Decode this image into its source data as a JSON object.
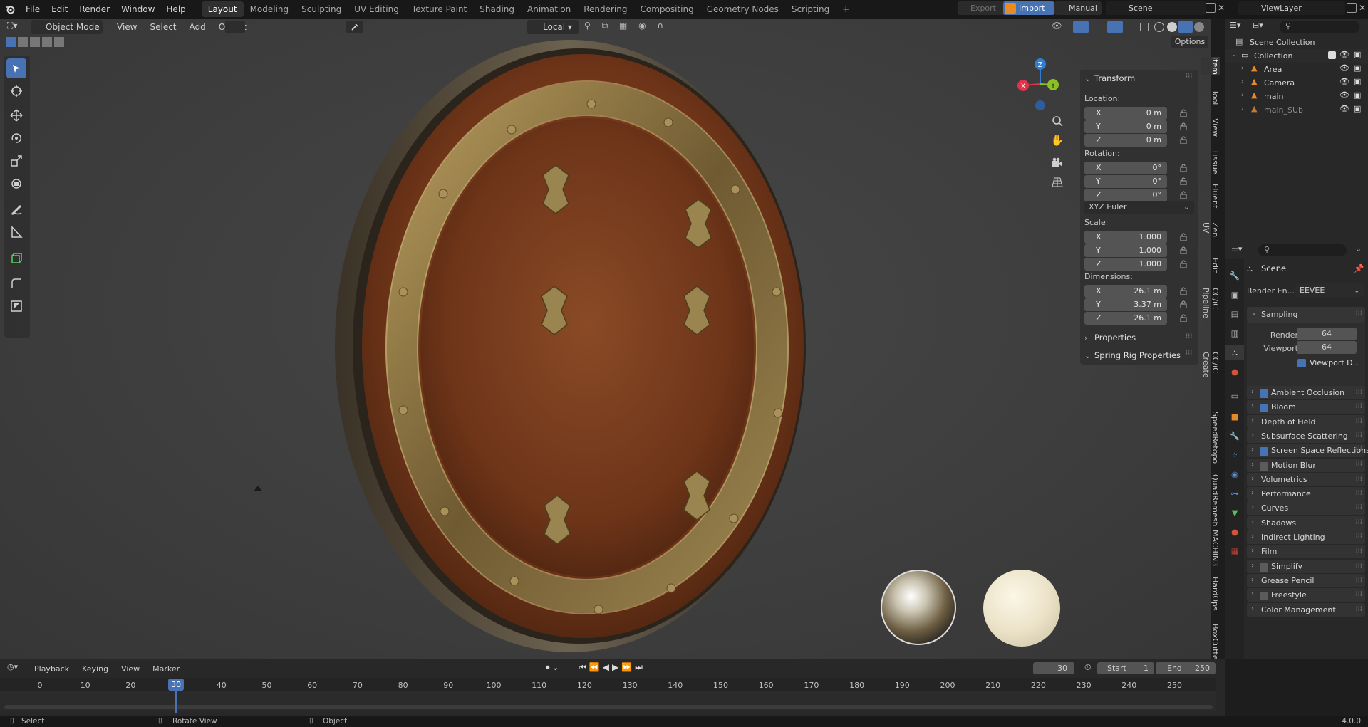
{
  "topbar": {
    "menus": [
      "File",
      "Edit",
      "Render",
      "Window",
      "Help"
    ],
    "workspaces": [
      "Layout",
      "Modeling",
      "Sculpting",
      "UV Editing",
      "Texture Paint",
      "Shading",
      "Animation",
      "Rendering",
      "Compositing",
      "Geometry Nodes",
      "Scripting"
    ],
    "active_workspace": "Layout",
    "add_tab": "+",
    "export_label": "Export",
    "import_label": "Import",
    "manual_label": "Manual",
    "scene_name": "Scene",
    "view_layer": "ViewLayer"
  },
  "viewport_header": {
    "mode": "Object Mode",
    "menus": [
      "View",
      "Select",
      "Add",
      "Object"
    ],
    "pivot": "Local",
    "options_label": "Options"
  },
  "gizmo": {
    "x": "X",
    "y": "Y",
    "z": "Z"
  },
  "n_panel": {
    "transform_title": "Transform",
    "location_label": "Location:",
    "location": [
      {
        "axis": "X",
        "value": "0 m"
      },
      {
        "axis": "Y",
        "value": "0 m"
      },
      {
        "axis": "Z",
        "value": "0 m"
      }
    ],
    "rotation_label": "Rotation:",
    "rotation": [
      {
        "axis": "X",
        "value": "0°"
      },
      {
        "axis": "Y",
        "value": "0°"
      },
      {
        "axis": "Z",
        "value": "0°"
      }
    ],
    "rotation_mode": "XYZ Euler",
    "scale_label": "Scale:",
    "scale": [
      {
        "axis": "X",
        "value": "1.000"
      },
      {
        "axis": "Y",
        "value": "1.000"
      },
      {
        "axis": "Z",
        "value": "1.000"
      }
    ],
    "dimensions_label": "Dimensions:",
    "dimensions": [
      {
        "axis": "X",
        "value": "26.1 m"
      },
      {
        "axis": "Y",
        "value": "3.37 m"
      },
      {
        "axis": "Z",
        "value": "26.1 m"
      }
    ],
    "properties_label": "Properties",
    "spring_rig_label": "Spring Rig Properties"
  },
  "side_tabs": [
    "Item",
    "Tool",
    "View",
    "Tissue",
    "Fluent",
    "Zen UV",
    "Edit",
    "CC/iC Pipeline",
    "CC/iC Create",
    "SpeedRetopo",
    "QuadRemesh",
    "MACHIN3",
    "HardOps",
    "BoxCutter"
  ],
  "outliner": {
    "root": "Scene Collection",
    "collection": "Collection",
    "items": [
      {
        "name": "Area",
        "dim": false
      },
      {
        "name": "Camera",
        "dim": false
      },
      {
        "name": "main",
        "dim": false
      },
      {
        "name": "main_SUb",
        "dim": true
      }
    ]
  },
  "properties": {
    "context": "Scene",
    "render_engine_label": "Render En...",
    "render_engine": "EEVEE",
    "sampling_title": "Sampling",
    "render_label": "Render",
    "render_value": "64",
    "viewport_label": "Viewport",
    "viewport_value": "64",
    "viewport_denoise": "Viewport D...",
    "sections": [
      {
        "label": "Ambient Occlusion",
        "checkbox": true,
        "checked": true
      },
      {
        "label": "Bloom",
        "checkbox": true,
        "checked": true
      },
      {
        "label": "Depth of Field",
        "checkbox": false,
        "checked": false
      },
      {
        "label": "Subsurface Scattering",
        "checkbox": false,
        "checked": false
      },
      {
        "label": "Screen Space Reflections",
        "checkbox": true,
        "checked": true
      },
      {
        "label": "Motion Blur",
        "checkbox": true,
        "checked": false
      },
      {
        "label": "Volumetrics",
        "checkbox": false,
        "checked": false
      },
      {
        "label": "Performance",
        "checkbox": false,
        "checked": false
      },
      {
        "label": "Curves",
        "checkbox": false,
        "checked": false
      },
      {
        "label": "Shadows",
        "checkbox": false,
        "checked": false
      },
      {
        "label": "Indirect Lighting",
        "checkbox": false,
        "checked": false
      },
      {
        "label": "Film",
        "checkbox": false,
        "checked": false
      },
      {
        "label": "Simplify",
        "checkbox": true,
        "checked": false
      },
      {
        "label": "Grease Pencil",
        "checkbox": false,
        "checked": false
      },
      {
        "label": "Freestyle",
        "checkbox": true,
        "checked": false
      },
      {
        "label": "Color Management",
        "checkbox": false,
        "checked": false
      }
    ]
  },
  "timeline": {
    "menus": [
      "Playback",
      "Keying",
      "View",
      "Marker"
    ],
    "current_frame": "30",
    "start_label": "Start",
    "start_value": "1",
    "end_label": "End",
    "end_value": "250",
    "ticks": [
      "0",
      "10",
      "20",
      "30",
      "40",
      "50",
      "60",
      "70",
      "80",
      "90",
      "100",
      "110",
      "120",
      "130",
      "140",
      "150",
      "160",
      "170",
      "180",
      "190",
      "200",
      "210",
      "220",
      "230",
      "240",
      "250"
    ],
    "playhead_frame": 30
  },
  "statusbar": {
    "select": "Select",
    "rotate": "Rotate View",
    "object": "Object",
    "version": "4.0.0"
  },
  "colors": {
    "accent": "#4772b3",
    "leather": "#7a3e1c",
    "brass": "#8a7548",
    "x_axis": "#e2334b",
    "y_axis": "#8ac226",
    "z_axis": "#2d7ed4"
  }
}
